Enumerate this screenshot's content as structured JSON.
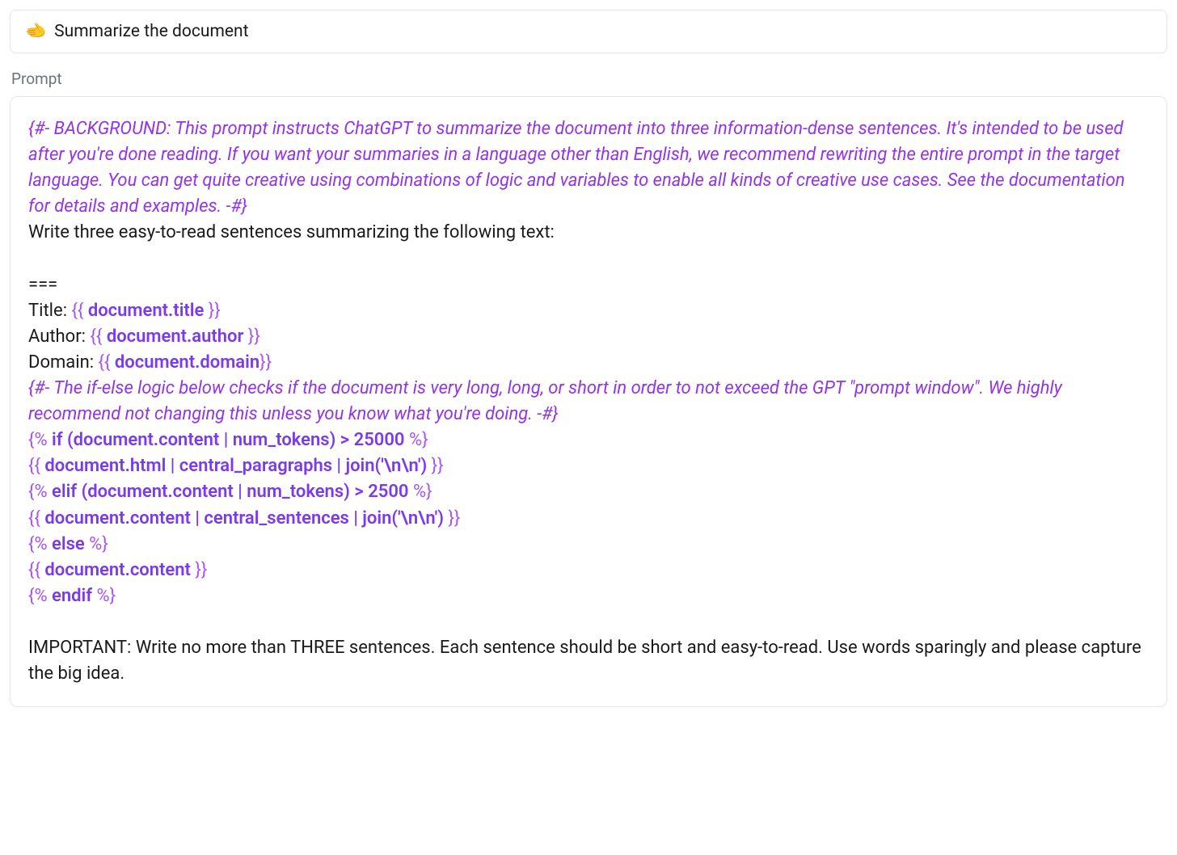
{
  "titleBar": {
    "icon": "🫲",
    "text": "Summarize the document"
  },
  "sectionLabel": "Prompt",
  "prompt": {
    "comment1": "{#- BACKGROUND: This prompt instructs ChatGPT to summarize the document into three information-dense sentences. It's intended to be used after you're done reading. If you want your summaries in a language other than English, we recommend rewriting the entire prompt in the target language. You can get quite creative using combinations of logic and variables to enable all kinds of creative use cases. See the documentation for details and examples. -#}",
    "intro": "Write three easy-to-read sentences summarizing the following text:",
    "sep": "===",
    "titleLabel": "Title: ",
    "titleVarOpen": "{{ ",
    "titleVar": "document.title",
    "titleVarClose": " }}",
    "authorLabel": "Author: ",
    "authorVarOpen": "{{ ",
    "authorVar": "document.author",
    "authorVarClose": " }}",
    "domainLabel": "Domain: ",
    "domainVarOpen": "{{ ",
    "domainVar": "document.domain",
    "domainVarClose": "}}",
    "comment2": "{#- The if-else logic below checks if the document is very long, long, or short in order to not exceed the GPT \"prompt window\". We highly recommend not changing this unless you know what you're doing. -#}",
    "ifOpen": "{% ",
    "ifBody": "if (document.content | num_tokens) > 25000",
    "ifClose": " %}",
    "branch1Open": "{{ ",
    "branch1Body": "document.html | central_paragraphs | join('\\n\\n')",
    "branch1Close": " }}",
    "elifOpen": "{% ",
    "elifBody": "elif (document.content | num_tokens) > 2500",
    "elifClose": " %}",
    "branch2Open": "{{ ",
    "branch2Body": "document.content | central_sentences | join('\\n\\n')",
    "branch2Close": " }}",
    "elseOpen": "{% ",
    "elseBody": "else",
    "elseClose": " %}",
    "branch3Open": "{{ ",
    "branch3Body": "document.content",
    "branch3Close": " }}",
    "endifOpen": "{% ",
    "endifBody": "endif",
    "endifClose": " %}",
    "outro": "IMPORTANT: Write no more than THREE sentences. Each sentence should be short and easy-to-read. Use words sparingly and please capture the big idea."
  }
}
